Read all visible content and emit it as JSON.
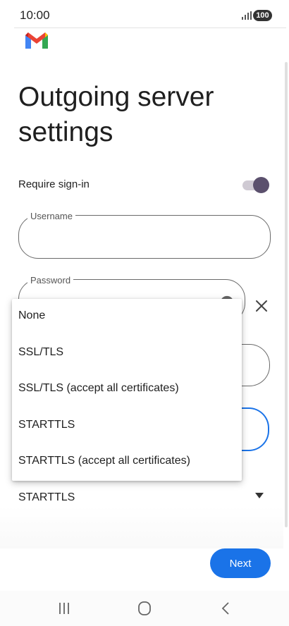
{
  "status_bar": {
    "time": "10:00",
    "battery": "100"
  },
  "header": {
    "title": "Outgoing server settings"
  },
  "require_sign_in": {
    "label": "Require sign-in",
    "enabled": true
  },
  "username_field": {
    "label": "Username",
    "value": ""
  },
  "password_field": {
    "label": "Password",
    "value": ""
  },
  "security_dropdown": {
    "options": [
      "None",
      "SSL/TLS",
      "SSL/TLS (accept all certificates)",
      "STARTTLS",
      "STARTTLS (accept all certificates)"
    ],
    "selected": "STARTTLS"
  },
  "actions": {
    "next_label": "Next"
  },
  "colors": {
    "accent": "#1a73e8",
    "toggle_thumb": "#5b506d"
  },
  "icons": [
    "signal-icon",
    "gmail-logo-icon",
    "visibility-icon",
    "clear-icon",
    "dropdown-arrow-icon",
    "recent-apps-icon",
    "home-icon",
    "back-icon"
  ]
}
